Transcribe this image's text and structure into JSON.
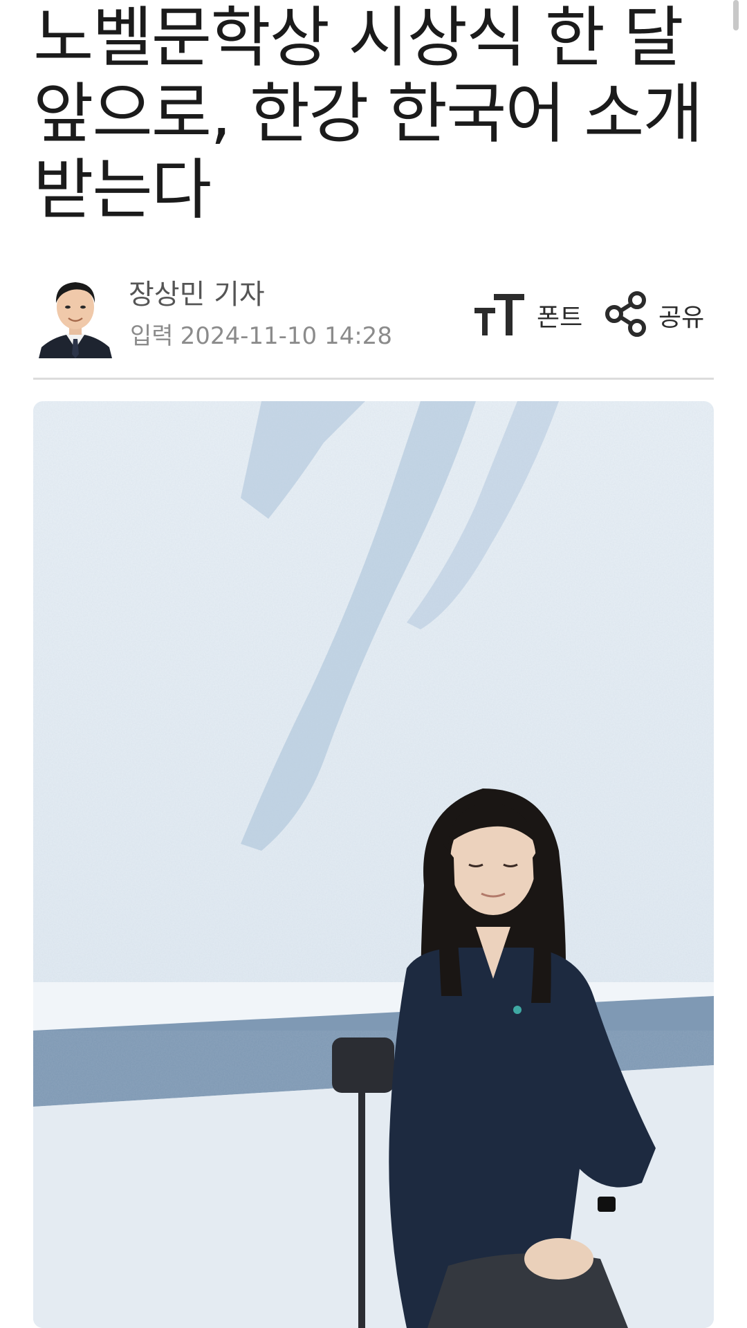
{
  "article": {
    "headline_lines": [
      "노벨문학상 시상식 한 달",
      "앞으로, 한강 한국어 소개",
      "받는다"
    ]
  },
  "byline": {
    "author": "장상민 기자",
    "published_label": "입력",
    "published_at": "2024-11-10 14:28"
  },
  "toolbar": {
    "font_label": "폰트",
    "share_label": "공유"
  },
  "icons": {
    "font": "font-size-icon",
    "share": "share-icon"
  }
}
